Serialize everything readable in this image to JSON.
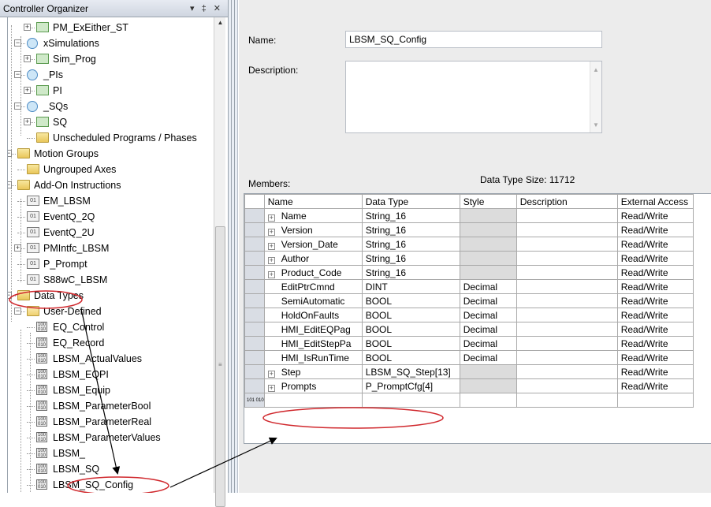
{
  "organizer": {
    "title": "Controller Organizer",
    "title_buttons": "▾ ‡ ✕",
    "tree": [
      {
        "label": "PM_ExEither_ST",
        "icon": "program-icon"
      },
      {
        "label": "xSimulations",
        "icon": "task-icon"
      },
      {
        "label": "Sim_Prog",
        "icon": "program-icon"
      },
      {
        "label": "_PIs",
        "icon": "task-icon"
      },
      {
        "label": "PI",
        "icon": "program-icon"
      },
      {
        "label": "_SQs",
        "icon": "task-icon"
      },
      {
        "label": "SQ",
        "icon": "program-icon"
      },
      {
        "label": "Unscheduled Programs / Phases",
        "icon": "folder-icon"
      },
      {
        "label": "Motion Groups",
        "icon": "folder-icon"
      },
      {
        "label": "Ungrouped Axes",
        "icon": "folder-icon"
      },
      {
        "label": "Add-On Instructions",
        "icon": "folder-icon"
      },
      {
        "label": "EM_LBSM",
        "icon": "aoi-icon"
      },
      {
        "label": "EventQ_2Q",
        "icon": "aoi-icon"
      },
      {
        "label": "EventQ_2U",
        "icon": "aoi-icon"
      },
      {
        "label": "PMIntfc_LBSM",
        "icon": "aoi-icon"
      },
      {
        "label": "P_Prompt",
        "icon": "aoi-icon"
      },
      {
        "label": "S88wC_LBSM",
        "icon": "aoi-icon"
      },
      {
        "label": "Data Types",
        "icon": "folder-icon"
      },
      {
        "label": "User-Defined",
        "icon": "udt-folder-icon"
      },
      {
        "label": "EQ_Control",
        "icon": "udt-icon"
      },
      {
        "label": "EQ_Record",
        "icon": "udt-icon"
      },
      {
        "label": "LBSM_ActualValues",
        "icon": "udt-icon"
      },
      {
        "label": "LBSM_EQPI",
        "icon": "udt-icon"
      },
      {
        "label": "LBSM_Equip",
        "icon": "udt-icon"
      },
      {
        "label": "LBSM_ParameterBool",
        "icon": "udt-icon"
      },
      {
        "label": "LBSM_ParameterReal",
        "icon": "udt-icon"
      },
      {
        "label": "LBSM_ParameterValues",
        "icon": "udt-icon"
      },
      {
        "label": "LBSM_",
        "icon": "udt-icon"
      },
      {
        "label": "LBSM_SQ",
        "icon": "udt-icon"
      },
      {
        "label": "LBSM_SQ_Config",
        "icon": "udt-icon"
      }
    ]
  },
  "editor": {
    "name_label": "Name:",
    "name_value": "LBSM_SQ_Config",
    "description_label": "Description:",
    "description_value": "",
    "members_label": "Members:",
    "size_text": "Data Type Size: 11712"
  },
  "members": {
    "columns": [
      "Name",
      "Data Type",
      "Style",
      "Description",
      "External Access"
    ],
    "rows": [
      {
        "name": "Name",
        "type": "String_16",
        "style": "",
        "desc": "",
        "access": "Read/Write",
        "expand": true
      },
      {
        "name": "Version",
        "type": "String_16",
        "style": "",
        "desc": "",
        "access": "Read/Write",
        "expand": true
      },
      {
        "name": "Version_Date",
        "type": "String_16",
        "style": "",
        "desc": "",
        "access": "Read/Write",
        "expand": true
      },
      {
        "name": "Author",
        "type": "String_16",
        "style": "",
        "desc": "",
        "access": "Read/Write",
        "expand": true
      },
      {
        "name": "Product_Code",
        "type": "String_16",
        "style": "",
        "desc": "",
        "access": "Read/Write",
        "expand": true
      },
      {
        "name": "EditPtrCmnd",
        "type": "DINT",
        "style": "Decimal",
        "desc": "",
        "access": "Read/Write",
        "expand": false
      },
      {
        "name": "SemiAutomatic",
        "type": "BOOL",
        "style": "Decimal",
        "desc": "",
        "access": "Read/Write",
        "expand": false
      },
      {
        "name": "HoldOnFaults",
        "type": "BOOL",
        "style": "Decimal",
        "desc": "",
        "access": "Read/Write",
        "expand": false
      },
      {
        "name": "HMI_EditEQPag",
        "type": "BOOL",
        "style": "Decimal",
        "desc": "",
        "access": "Read/Write",
        "expand": false
      },
      {
        "name": "HMI_EditStepPa",
        "type": "BOOL",
        "style": "Decimal",
        "desc": "",
        "access": "Read/Write",
        "expand": false
      },
      {
        "name": "HMI_IsRunTime",
        "type": "BOOL",
        "style": "Decimal",
        "desc": "",
        "access": "Read/Write",
        "expand": false
      },
      {
        "name": "Step",
        "type": "LBSM_SQ_Step[13]",
        "style": "",
        "desc": "",
        "access": "Read/Write",
        "expand": true
      },
      {
        "name": "Prompts",
        "type": "P_PromptCfg[4]",
        "style": "",
        "desc": "",
        "access": "Read/Write",
        "expand": true
      }
    ],
    "new_row_marker": "101 010"
  },
  "annotation": {
    "color": "#d0282d"
  }
}
